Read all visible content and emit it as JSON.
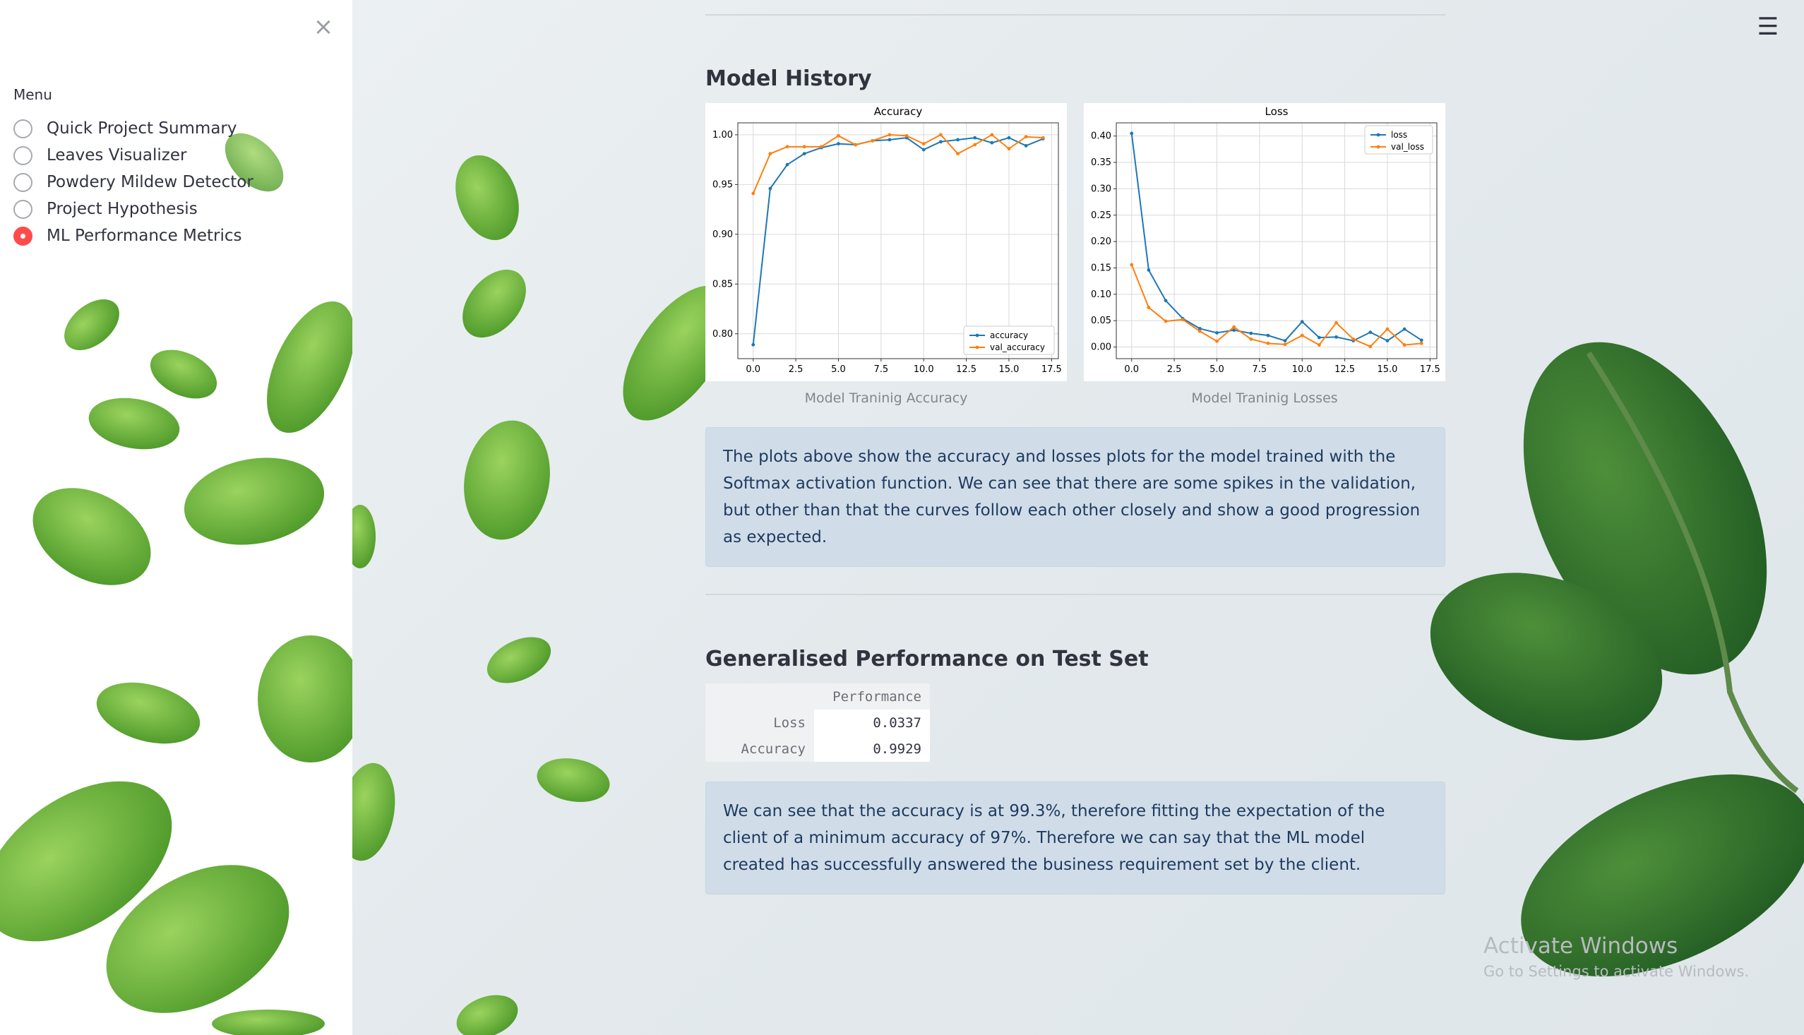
{
  "sidebar": {
    "close_symbol": "×",
    "menu_label": "Menu",
    "items": [
      {
        "label": "Quick Project Summary",
        "selected": false
      },
      {
        "label": "Leaves Visualizer",
        "selected": false
      },
      {
        "label": "Powdery Mildew Detector",
        "selected": false
      },
      {
        "label": "Project Hypothesis",
        "selected": false
      },
      {
        "label": "ML Performance Metrics",
        "selected": true
      }
    ]
  },
  "header": {
    "menu_symbol": "☰"
  },
  "main": {
    "model_history_title": "Model History",
    "accuracy_caption": "Model Traninig Accuracy",
    "loss_caption": "Model Traninig Losses",
    "history_note": "The plots above show the accuracy and losses plots for the model trained with the Softmax activation function. We can see that there are some spikes in the validation, but other than that the curves follow each other closely and show a good progression as expected.",
    "test_title": "Generalised Performance on Test Set",
    "table": {
      "column": "Performance",
      "rows": [
        {
          "label": "Loss",
          "value": "0.0337"
        },
        {
          "label": "Accuracy",
          "value": "0.9929"
        }
      ]
    },
    "test_note": "We can see that the accuracy is at 99.3%, therefore fitting the expectation of the client of a minimum accuracy of 97%. Therefore we can say that the ML model created has successfully answered the business requirement set by the client."
  },
  "watermark": {
    "title": "Activate Windows",
    "subtitle": "Go to Settings to activate Windows."
  },
  "colors": {
    "accent": "#ff4b4b",
    "series_blue": "#1f77b4",
    "series_orange": "#ff7f0e",
    "leaf_green": "#6fb83a"
  },
  "chart_data": [
    {
      "type": "line",
      "title": "Accuracy",
      "xlim": [
        -0.9,
        17.9
      ],
      "ylim": [
        0.775,
        1.012
      ],
      "xticks": [
        "0.0",
        "2.5",
        "5.0",
        "7.5",
        "10.0",
        "12.5",
        "15.0",
        "17.5"
      ],
      "yticks": [
        "0.80",
        "0.85",
        "0.90",
        "0.95",
        "1.00"
      ],
      "grid": true,
      "legend_position": "lower-right",
      "x": [
        0,
        1,
        2,
        3,
        4,
        5,
        6,
        7,
        8,
        9,
        10,
        11,
        12,
        13,
        14,
        15,
        16,
        17
      ],
      "series": [
        {
          "name": "accuracy",
          "color": "#1f77b4",
          "values": [
            0.789,
            0.946,
            0.97,
            0.981,
            0.987,
            0.991,
            0.99,
            0.994,
            0.995,
            0.997,
            0.985,
            0.993,
            0.995,
            0.997,
            0.992,
            0.997,
            0.989,
            0.996
          ]
        },
        {
          "name": "val_accuracy",
          "color": "#ff7f0e",
          "values": [
            0.941,
            0.981,
            0.988,
            0.988,
            0.988,
            0.999,
            0.99,
            0.994,
            1.0,
            0.999,
            0.991,
            1.0,
            0.981,
            0.99,
            1.0,
            0.986,
            0.998,
            0.997
          ]
        }
      ]
    },
    {
      "type": "line",
      "title": "Loss",
      "xlim": [
        -0.9,
        17.9
      ],
      "ylim": [
        -0.022,
        0.425
      ],
      "xticks": [
        "0.0",
        "2.5",
        "5.0",
        "7.5",
        "10.0",
        "12.5",
        "15.0",
        "17.5"
      ],
      "yticks": [
        "0.00",
        "0.05",
        "0.10",
        "0.15",
        "0.20",
        "0.25",
        "0.30",
        "0.35",
        "0.40"
      ],
      "grid": true,
      "legend_position": "top-right",
      "x": [
        0,
        1,
        2,
        3,
        4,
        5,
        6,
        7,
        8,
        9,
        10,
        11,
        12,
        13,
        14,
        15,
        16,
        17
      ],
      "series": [
        {
          "name": "loss",
          "color": "#1f77b4",
          "values": [
            0.405,
            0.146,
            0.088,
            0.054,
            0.035,
            0.027,
            0.032,
            0.026,
            0.022,
            0.012,
            0.048,
            0.018,
            0.019,
            0.012,
            0.028,
            0.012,
            0.034,
            0.013
          ]
        },
        {
          "name": "val_loss",
          "color": "#ff7f0e",
          "values": [
            0.156,
            0.075,
            0.049,
            0.052,
            0.03,
            0.011,
            0.038,
            0.015,
            0.007,
            0.005,
            0.022,
            0.004,
            0.046,
            0.015,
            0.001,
            0.034,
            0.004,
            0.007
          ]
        }
      ]
    }
  ]
}
